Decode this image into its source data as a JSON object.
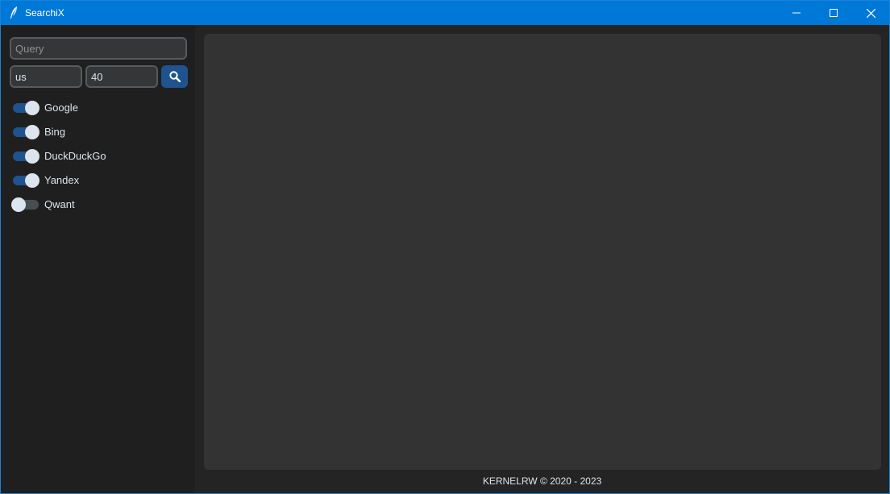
{
  "window": {
    "title": "SearchiX",
    "app_icon": "feather-icon",
    "controls": [
      "minimize-icon",
      "maximize-icon",
      "close-icon"
    ]
  },
  "sidebar": {
    "query": {
      "placeholder": "Query",
      "value": ""
    },
    "region": {
      "value": "us"
    },
    "count": {
      "value": "40"
    },
    "search_button_icon": "search-icon",
    "engines": [
      {
        "label": "Google",
        "enabled": true
      },
      {
        "label": "Bing",
        "enabled": true
      },
      {
        "label": "DuckDuckGo",
        "enabled": true
      },
      {
        "label": "Yandex",
        "enabled": true
      },
      {
        "label": "Qwant",
        "enabled": false
      }
    ]
  },
  "main": {
    "footer": "KERNELRW © 2020 - 2023"
  },
  "colors": {
    "titlebar": "#0078d7",
    "accent": "#1f538d",
    "panel": "#333333",
    "sidebar": "#1f1f1f"
  }
}
